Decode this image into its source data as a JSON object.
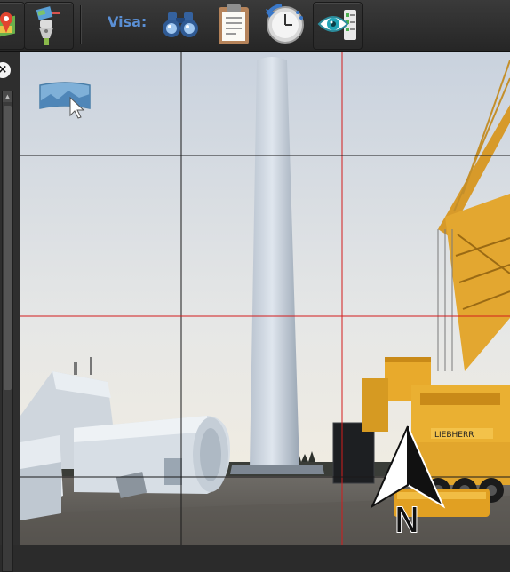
{
  "toolbar": {
    "visa_label": "Visa:",
    "buttons": [
      {
        "name": "map-marker-icon"
      },
      {
        "name": "grinder-settings-icon"
      }
    ],
    "view_icons": [
      {
        "name": "binoculars-icon"
      },
      {
        "name": "clipboard-icon"
      },
      {
        "name": "clock-history-icon"
      },
      {
        "name": "eye-checklist-icon"
      }
    ]
  },
  "sidebar": {
    "close_symbol": "×"
  },
  "viewer": {
    "compass_label": "N",
    "pano_button": "panorama-view-icon",
    "grid_color_dark": "#1a1a1a",
    "grid_color_red": "#d31c1c"
  }
}
